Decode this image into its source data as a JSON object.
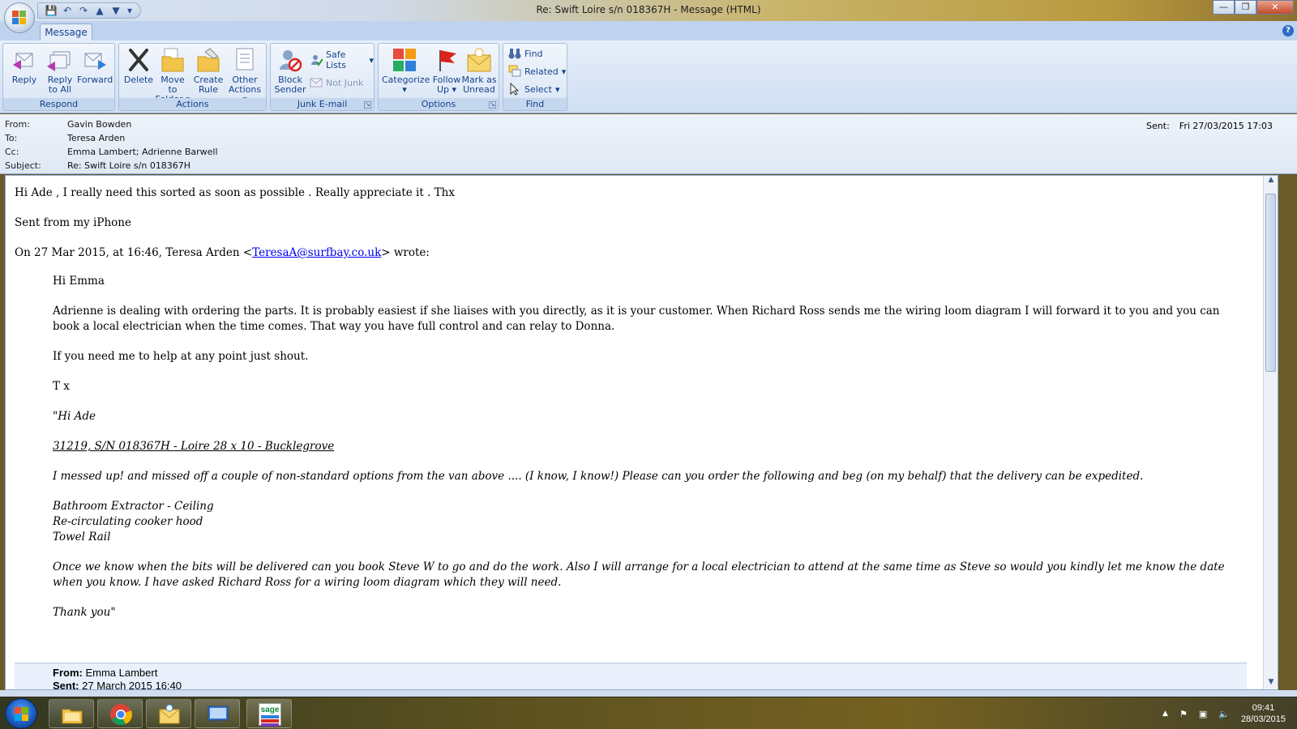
{
  "window": {
    "title": "Re: Swift Loire s/n 018367H - Message (HTML)",
    "controls": {
      "minimize": "—",
      "maximize": "❐",
      "close": "✕"
    }
  },
  "quick_access": [
    "save-icon",
    "undo-icon",
    "redo-icon",
    "previous-item-icon",
    "next-item-icon",
    "customize-icon"
  ],
  "ribbon": {
    "active_tab": "Message",
    "help": "?",
    "groups": {
      "respond": {
        "label": "Respond",
        "reply": "Reply",
        "reply_all_1": "Reply",
        "reply_all_2": "to All",
        "forward": "Forward"
      },
      "actions": {
        "label": "Actions",
        "delete": "Delete",
        "move_1": "Move to",
        "move_2": "Folder",
        "create_rule_1": "Create",
        "create_rule_2": "Rule",
        "other_1": "Other",
        "other_2": "Actions"
      },
      "junk": {
        "label": "Junk E-mail",
        "block_1": "Block",
        "block_2": "Sender",
        "safe_lists": "Safe Lists",
        "not_junk": "Not Junk"
      },
      "options": {
        "label": "Options",
        "categorize": "Categorize",
        "follow_1": "Follow",
        "follow_2": "Up",
        "mark_1": "Mark as",
        "mark_2": "Unread"
      },
      "find": {
        "label": "Find",
        "find": "Find",
        "related": "Related",
        "select": "Select"
      }
    }
  },
  "header": {
    "from_label": "From:",
    "from": "Gavin Bowden",
    "to_label": "To:",
    "to": "Teresa Arden",
    "cc_label": "Cc:",
    "cc": "Emma Lambert; Adrienne Barwell",
    "subject_label": "Subject:",
    "subject": "Re: Swift Loire s/n 018367H",
    "sent_label": "Sent:",
    "sent": "Fri 27/03/2015 17:03"
  },
  "body": {
    "line1": "Hi Ade , I really need this sorted as soon as possible . Really appreciate it . Thx",
    "line2": "Sent from my iPhone",
    "wrote_prefix": "On 27 Mar 2015, at 16:46, Teresa Arden <",
    "wrote_link": "TeresaA@surfbay.co.uk",
    "wrote_suffix": "> wrote:",
    "quoted": {
      "greeting": "Hi Emma",
      "para1": "Adrienne is dealing with ordering the parts.  It is probably easiest if she liaises with you directly, as it is your customer.  When Richard Ross sends me the wiring loom diagram I will forward it to you and you can book a local electrician when the time comes.  That way you have full control and can relay to Donna.",
      "para2": "If you need me to help at any point just shout.",
      "sign": "T x",
      "inner_greeting": "\"Hi Ade",
      "inner_ref": "31219, S/N 018367H - Loire 28 x 10 - Bucklegrove",
      "inner_para1": "I messed up! and missed off a couple of non-standard options from the van above .... (I know, I know!)  Please can you order the following and beg (on my behalf) that the delivery can be expedited.",
      "items": [
        "Bathroom Extractor - Ceiling",
        "Re-circulating cooker hood",
        "Towel Rail"
      ],
      "inner_para2": "Once we know when the bits will be delivered can you book Steve W to go and do the work.  Also I will arrange for a local electrician to attend at the same time as Steve so would you kindly let me know the date when you know.  I have asked Richard Ross for a wiring loom diagram which they will need.",
      "inner_thanks": "Thank you\""
    },
    "forwarded": {
      "from_label": "From:",
      "from": "Emma Lambert",
      "sent_label": "Sent:",
      "sent": "27 March 2015 16:40"
    }
  },
  "taskbar": {
    "apps": [
      "explorer-icon",
      "chrome-icon",
      "outlook-icon",
      "remote-desktop-icon",
      "sage-icon"
    ],
    "sage_text": "sage",
    "time": "09:41",
    "date": "28/03/2015",
    "tray_arrow": "▲"
  }
}
